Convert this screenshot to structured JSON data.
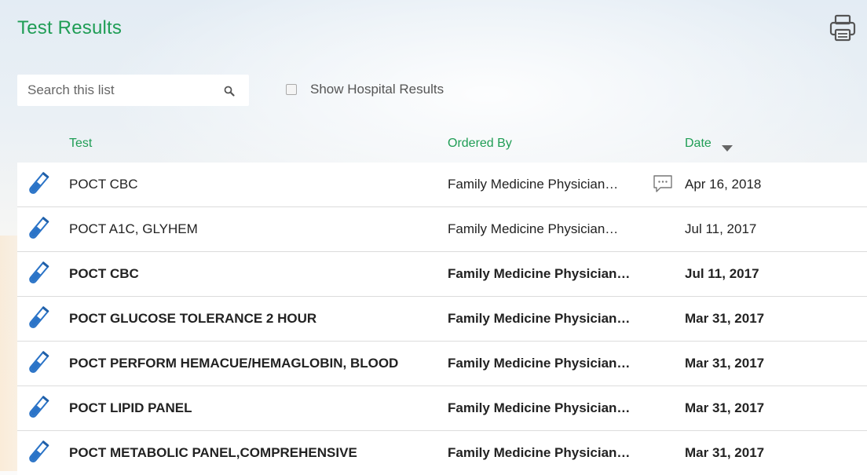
{
  "page": {
    "title": "Test Results"
  },
  "search": {
    "placeholder": "Search this list",
    "value": ""
  },
  "filter": {
    "label": "Show Hospital Results",
    "checked": false
  },
  "columns": {
    "test": "Test",
    "ordered_by": "Ordered By",
    "date": "Date",
    "sort": "descending"
  },
  "colors": {
    "accent": "#1f9d55",
    "icon_blue": "#2a73c7"
  },
  "rows": [
    {
      "test": "POCT CBC",
      "ordered_by": "Family Medicine Physician…",
      "date": "Apr 16, 2018",
      "unread": false,
      "has_message": true
    },
    {
      "test": "POCT A1C, GLYHEM",
      "ordered_by": "Family Medicine Physician…",
      "date": "Jul 11, 2017",
      "unread": false,
      "has_message": false
    },
    {
      "test": "POCT CBC",
      "ordered_by": "Family Medicine Physician…",
      "date": "Jul 11, 2017",
      "unread": true,
      "has_message": false
    },
    {
      "test": "POCT GLUCOSE TOLERANCE 2 HOUR",
      "ordered_by": "Family Medicine Physician…",
      "date": "Mar 31, 2017",
      "unread": true,
      "has_message": false
    },
    {
      "test": "POCT PERFORM HEMACUE/HEMAGLOBIN, BLOOD",
      "ordered_by": "Family Medicine Physician…",
      "date": "Mar 31, 2017",
      "unread": true,
      "has_message": false
    },
    {
      "test": "POCT LIPID PANEL",
      "ordered_by": "Family Medicine Physician…",
      "date": "Mar 31, 2017",
      "unread": true,
      "has_message": false
    },
    {
      "test": "POCT METABOLIC PANEL,COMPREHENSIVE",
      "ordered_by": "Family Medicine Physician…",
      "date": "Mar 31, 2017",
      "unread": true,
      "has_message": false
    }
  ]
}
